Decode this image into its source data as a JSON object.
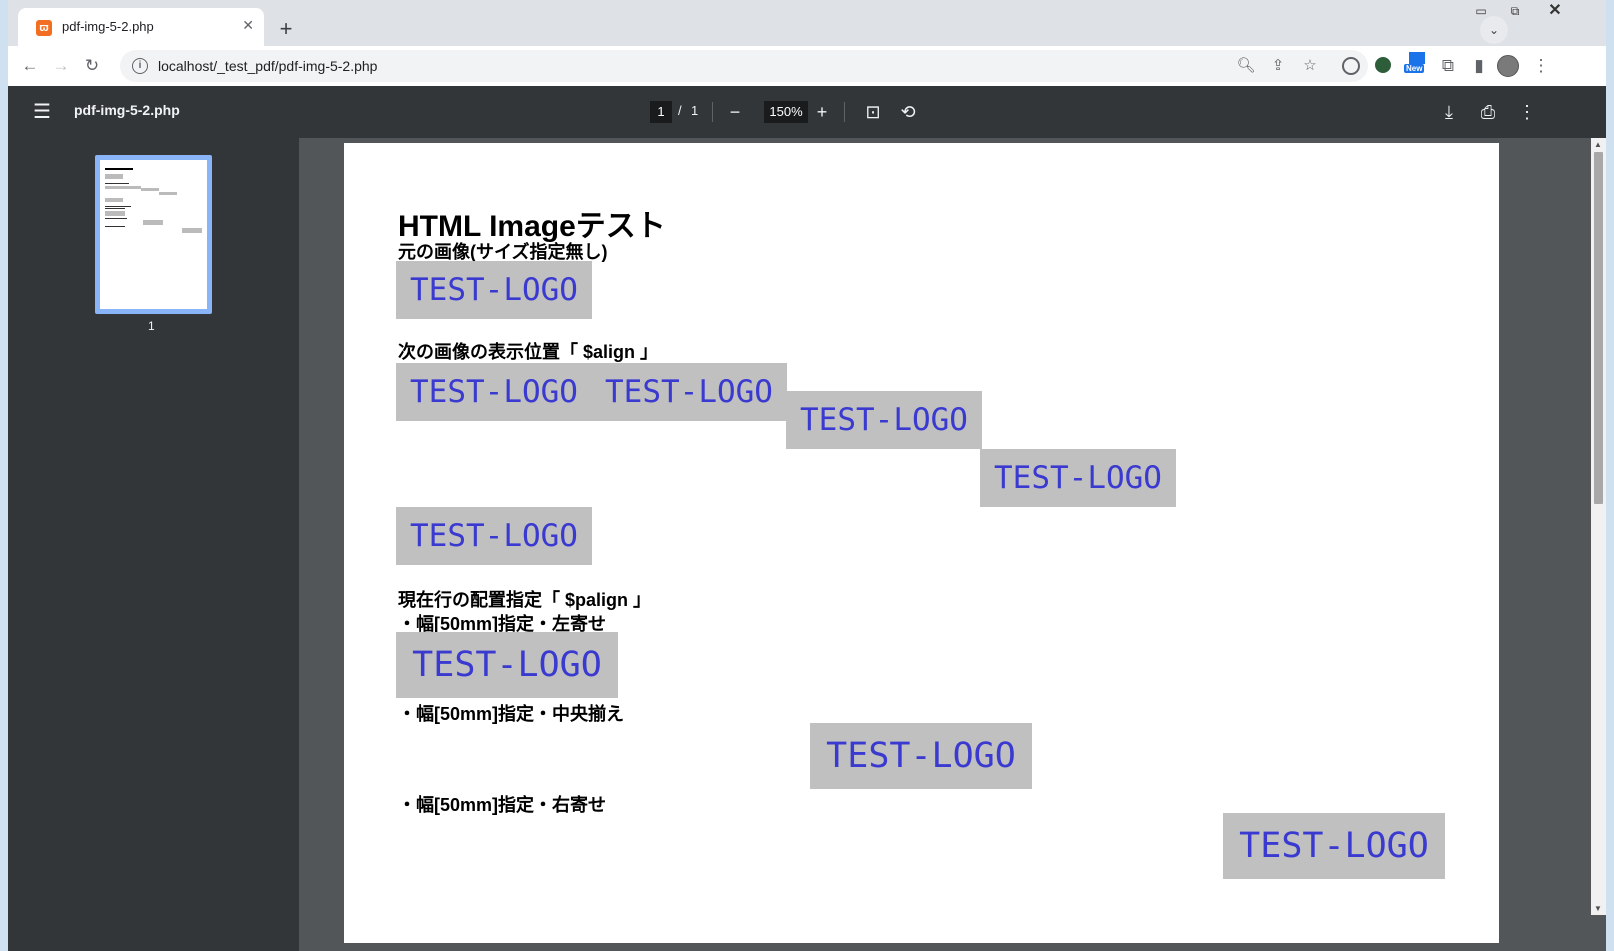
{
  "browser": {
    "tab_title": "pdf-img-5-2.php",
    "tab_favicon": "xampp-icon",
    "url": "localhost/_test_pdf/pdf-img-5-2.php",
    "extension_badge": "New"
  },
  "pdf_viewer": {
    "file_name": "pdf-img-5-2.php",
    "current_page": "1",
    "page_separator": "/",
    "total_pages": "1",
    "zoom": "150%",
    "thumbnail_label": "1"
  },
  "document": {
    "title": "HTML Imageテスト",
    "section1_heading": "元の画像(サイズ指定無し)",
    "section2_heading": "次の画像の表示位置「 $align 」",
    "section3_heading": "現在行の配置指定「 $palign 」",
    "left_label": "・幅[50mm]指定・左寄せ",
    "center_label": "・幅[50mm]指定・中央揃え",
    "right_label": "・幅[50mm]指定・右寄せ",
    "logo_text": "TEST-LOGO"
  },
  "colors": {
    "logo_bg": "#c0c0c0",
    "logo_text": "#3a3ad0",
    "viewer_bar": "#323639",
    "viewer_bg": "#525659"
  }
}
